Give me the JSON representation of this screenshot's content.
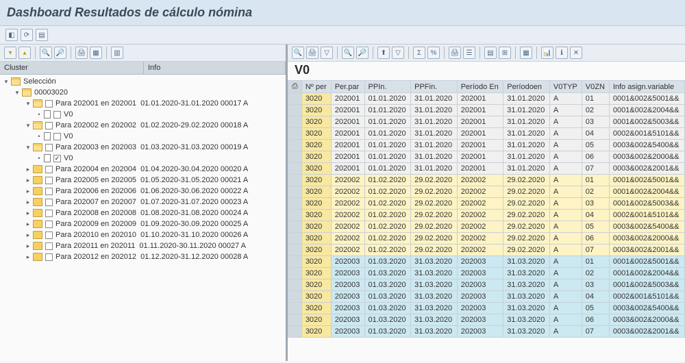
{
  "title": "Dashboard Resultados de cálculo nómina",
  "detailTitle": "V0",
  "treeHeaders": {
    "cluster": "Cluster",
    "info": "Info"
  },
  "tree": {
    "root": {
      "label": "Selección"
    },
    "pernr": {
      "label": "00003020"
    },
    "periods": [
      {
        "label": "Para 202001 en 202001",
        "info": "01.01.2020-31.01.2020 00017 A",
        "expanded": true,
        "v0": true
      },
      {
        "label": "Para 202002 en 202002",
        "info": "01.02.2020-29.02.2020 00018 A",
        "expanded": true,
        "v0": true
      },
      {
        "label": "Para 202003 en 202003",
        "info": "01.03.2020-31.03.2020 00019 A",
        "expanded": true,
        "v0": true,
        "v0checked": true
      },
      {
        "label": "Para 202004 en 202004",
        "info": "01.04.2020-30.04.2020 00020 A",
        "expanded": false
      },
      {
        "label": "Para 202005 en 202005",
        "info": "01.05.2020-31.05.2020 00021 A",
        "expanded": false
      },
      {
        "label": "Para 202006 en 202006",
        "info": "01.06.2020-30.06.2020 00022 A",
        "expanded": false
      },
      {
        "label": "Para 202007 en 202007",
        "info": "01.07.2020-31.07.2020 00023 A",
        "expanded": false
      },
      {
        "label": "Para 202008 en 202008",
        "info": "01.08.2020-31.08.2020 00024 A",
        "expanded": false
      },
      {
        "label": "Para 202009 en 202009",
        "info": "01.09.2020-30.09.2020 00025 A",
        "expanded": false
      },
      {
        "label": "Para 202010 en 202010",
        "info": "01.10.2020-31.10.2020 00026 A",
        "expanded": false
      },
      {
        "label": "Para 202011 en 202011",
        "info": "01.11.2020-30.11.2020 00027 A",
        "expanded": false
      },
      {
        "label": "Para 202012 en 202012",
        "info": "01.12.2020-31.12.2020 00028 A",
        "expanded": false
      }
    ],
    "v0label": "V0"
  },
  "columns": [
    "Nº per",
    "Per.par",
    "PPIn.",
    "PPFin.",
    "Período En",
    "Períodoen",
    "V0TYP",
    "V0ZN",
    "Info asign.variable"
  ],
  "rows": [
    {
      "g": 0,
      "c": [
        "3020",
        "202001",
        "01.01.2020",
        "31.01.2020",
        "202001",
        "31.01.2020",
        "A",
        "01",
        "0001&002&5001&&"
      ]
    },
    {
      "g": 0,
      "c": [
        "3020",
        "202001",
        "01.01.2020",
        "31.01.2020",
        "202001",
        "31.01.2020",
        "A",
        "02",
        "0001&002&2004&&"
      ]
    },
    {
      "g": 0,
      "c": [
        "3020",
        "202001",
        "01.01.2020",
        "31.01.2020",
        "202001",
        "31.01.2020",
        "A",
        "03",
        "0001&002&5003&&"
      ]
    },
    {
      "g": 0,
      "c": [
        "3020",
        "202001",
        "01.01.2020",
        "31.01.2020",
        "202001",
        "31.01.2020",
        "A",
        "04",
        "0002&001&5101&&"
      ]
    },
    {
      "g": 0,
      "c": [
        "3020",
        "202001",
        "01.01.2020",
        "31.01.2020",
        "202001",
        "31.01.2020",
        "A",
        "05",
        "0003&002&5400&&"
      ]
    },
    {
      "g": 0,
      "c": [
        "3020",
        "202001",
        "01.01.2020",
        "31.01.2020",
        "202001",
        "31.01.2020",
        "A",
        "06",
        "0003&002&2000&&"
      ]
    },
    {
      "g": 0,
      "c": [
        "3020",
        "202001",
        "01.01.2020",
        "31.01.2020",
        "202001",
        "31.01.2020",
        "A",
        "07",
        "0003&002&2001&&"
      ]
    },
    {
      "g": 1,
      "c": [
        "3020",
        "202002",
        "01.02.2020",
        "29.02.2020",
        "202002",
        "29.02.2020",
        "A",
        "01",
        "0001&002&5001&&"
      ]
    },
    {
      "g": 1,
      "c": [
        "3020",
        "202002",
        "01.02.2020",
        "29.02.2020",
        "202002",
        "29.02.2020",
        "A",
        "02",
        "0001&002&2004&&"
      ]
    },
    {
      "g": 1,
      "c": [
        "3020",
        "202002",
        "01.02.2020",
        "29.02.2020",
        "202002",
        "29.02.2020",
        "A",
        "03",
        "0001&002&5003&&"
      ]
    },
    {
      "g": 1,
      "c": [
        "3020",
        "202002",
        "01.02.2020",
        "29.02.2020",
        "202002",
        "29.02.2020",
        "A",
        "04",
        "0002&001&5101&&"
      ]
    },
    {
      "g": 1,
      "c": [
        "3020",
        "202002",
        "01.02.2020",
        "29.02.2020",
        "202002",
        "29.02.2020",
        "A",
        "05",
        "0003&002&5400&&"
      ]
    },
    {
      "g": 1,
      "c": [
        "3020",
        "202002",
        "01.02.2020",
        "29.02.2020",
        "202002",
        "29.02.2020",
        "A",
        "06",
        "0003&002&2000&&"
      ]
    },
    {
      "g": 1,
      "c": [
        "3020",
        "202002",
        "01.02.2020",
        "29.02.2020",
        "202002",
        "29.02.2020",
        "A",
        "07",
        "0003&002&2001&&"
      ]
    },
    {
      "g": 2,
      "c": [
        "3020",
        "202003",
        "01.03.2020",
        "31.03.2020",
        "202003",
        "31.03.2020",
        "A",
        "01",
        "0001&002&5001&&"
      ]
    },
    {
      "g": 2,
      "c": [
        "3020",
        "202003",
        "01.03.2020",
        "31.03.2020",
        "202003",
        "31.03.2020",
        "A",
        "02",
        "0001&002&2004&&"
      ]
    },
    {
      "g": 2,
      "c": [
        "3020",
        "202003",
        "01.03.2020",
        "31.03.2020",
        "202003",
        "31.03.2020",
        "A",
        "03",
        "0001&002&5003&&"
      ]
    },
    {
      "g": 2,
      "c": [
        "3020",
        "202003",
        "01.03.2020",
        "31.03.2020",
        "202003",
        "31.03.2020",
        "A",
        "04",
        "0002&001&5101&&"
      ]
    },
    {
      "g": 2,
      "c": [
        "3020",
        "202003",
        "01.03.2020",
        "31.03.2020",
        "202003",
        "31.03.2020",
        "A",
        "05",
        "0003&002&5400&&"
      ]
    },
    {
      "g": 2,
      "c": [
        "3020",
        "202003",
        "01.03.2020",
        "31.03.2020",
        "202003",
        "31.03.2020",
        "A",
        "06",
        "0003&002&2000&&"
      ]
    },
    {
      "g": 2,
      "c": [
        "3020",
        "202003",
        "01.03.2020",
        "31.03.2020",
        "202003",
        "31.03.2020",
        "A",
        "07",
        "0003&002&2001&&"
      ]
    }
  ]
}
